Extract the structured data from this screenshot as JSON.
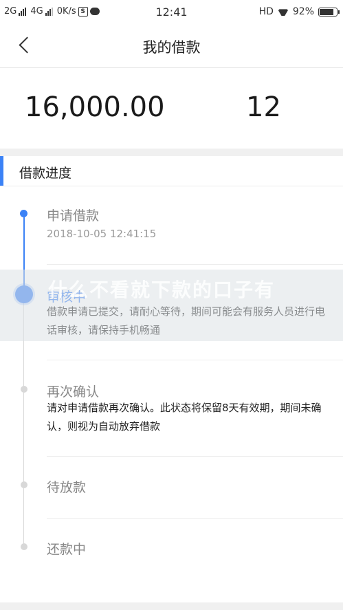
{
  "status_bar": {
    "sim1": "2G",
    "sim2": "4G",
    "speed": "0K/s",
    "box_glyph": "S",
    "time": "12:41",
    "network": "HD",
    "battery": "92%",
    "battery_level": 0.92
  },
  "nav": {
    "title": "我的借款"
  },
  "summary": {
    "amount": "16,000.00",
    "term": "12"
  },
  "progress": {
    "section_title": "借款进度",
    "steps": [
      {
        "title": "申请借款",
        "date": "2018-10-05 12:41:15"
      },
      {
        "title": "审核中",
        "desc": "借款申请已提交，请耐心等待，期间可能会有服务人员进行电话审核，请保持手机畅通"
      },
      {
        "title": "再次确认",
        "desc": "请对申请借款再次确认。此状态将保留8天有效期，期间未确认，则视为自动放弃借款"
      },
      {
        "title": "待放款"
      },
      {
        "title": "还款中"
      }
    ]
  },
  "watermark": {
    "text": "什么不看就下款的口子有"
  },
  "colors": {
    "accent": "#3b82f6",
    "inactive": "#d8d8d8"
  }
}
